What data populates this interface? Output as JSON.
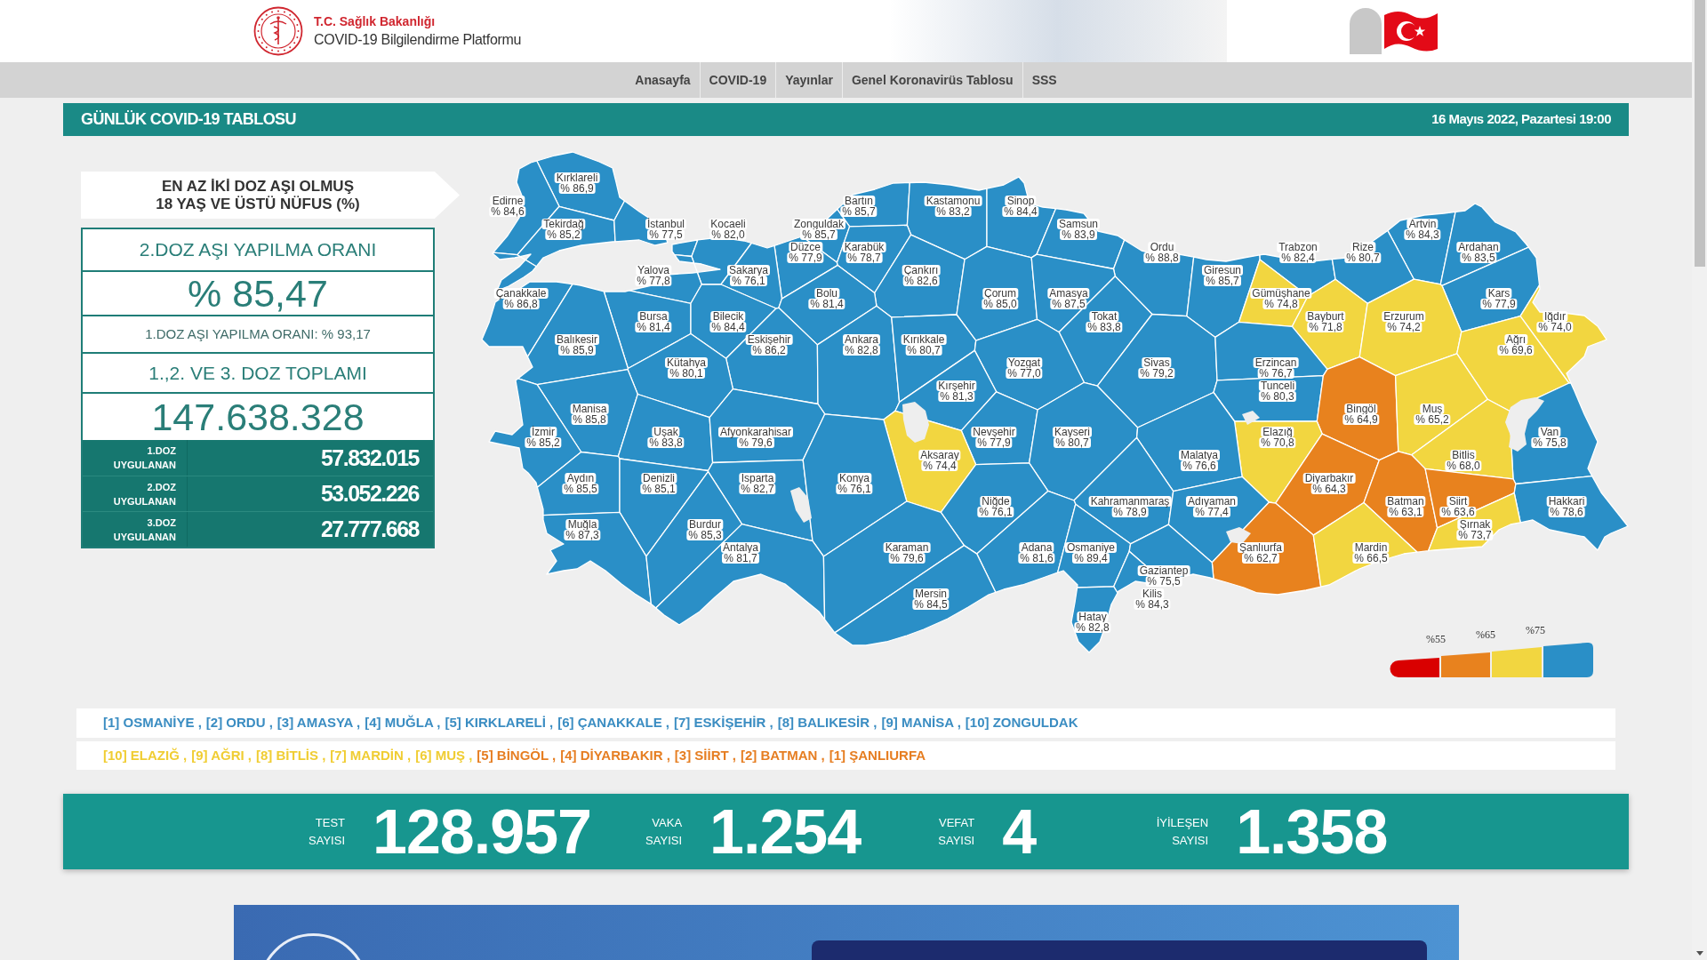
{
  "header": {
    "ministry": "T.C. Sağlık Bakanlığı",
    "platform": "COVID-19 Bilgilendirme Platformu"
  },
  "nav": [
    "Anasayfa",
    "COVID-19",
    "Yayınlar",
    "Genel Koronavirüs Tablosu",
    "SSS"
  ],
  "title_bar": {
    "title": "GÜNLÜK COVID-19 TABLOSU",
    "date": "16 Mayıs 2022, Pazartesi 19:00"
  },
  "vaccination": {
    "heading_lines": [
      "EN AZ İKİ DOZ AŞI OLMUŞ",
      "18 YAŞ VE ÜSTÜ NÜFUS (%)"
    ],
    "second_dose_label": "2.DOZ AŞI YAPILMA ORANI",
    "second_dose_rate": "% 85,47",
    "first_dose_rate": "1.DOZ AŞI YAPILMA ORANI: % 93,17",
    "total_label": "1.,2. VE 3. DOZ TOPLAMI",
    "total": "147.638.328",
    "doses": [
      {
        "label_lines": [
          "1.DOZ",
          "UYGULANAN"
        ],
        "value": "57.832.015"
      },
      {
        "label_lines": [
          "2.DOZ",
          "UYGULANAN"
        ],
        "value": "53.052.226"
      },
      {
        "label_lines": [
          "3.DOZ",
          "UYGULANAN"
        ],
        "value": "27.777.668"
      }
    ]
  },
  "map": {
    "provinces": [
      {
        "name": "Kırklareli",
        "value": "% 86,9",
        "color": "#2a8fc7"
      },
      {
        "name": "Edirne",
        "value": "% 84,6",
        "color": "#2a8fc7"
      },
      {
        "name": "Bartın",
        "value": "% 85,7",
        "color": "#2a8fc7"
      },
      {
        "name": "Kastamonu",
        "value": "% 83,2",
        "color": "#2a8fc7"
      },
      {
        "name": "Sinop",
        "value": "% 84,4",
        "color": "#2a8fc7"
      },
      {
        "name": "Tekirdağ",
        "value": "% 85,2",
        "color": "#2a8fc7"
      },
      {
        "name": "İstanbul",
        "value": "% 77,5",
        "color": "#2a8fc7"
      },
      {
        "name": "Kocaeli",
        "value": "% 82,0",
        "color": "#2a8fc7"
      },
      {
        "name": "Zonguldak",
        "value": "% 85,7",
        "color": "#2a8fc7"
      },
      {
        "name": "Samsun",
        "value": "% 83,9",
        "color": "#2a8fc7"
      },
      {
        "name": "Artvin",
        "value": "% 84,3",
        "color": "#2a8fc7"
      },
      {
        "name": "Düzce",
        "value": "% 77,9",
        "color": "#2a8fc7"
      },
      {
        "name": "Karabük",
        "value": "% 78,7",
        "color": "#2a8fc7"
      },
      {
        "name": "Ordu",
        "value": "% 88,8",
        "color": "#2a8fc7"
      },
      {
        "name": "Trabzon",
        "value": "% 82,4",
        "color": "#2a8fc7"
      },
      {
        "name": "Rize",
        "value": "% 80,7",
        "color": "#2a8fc7"
      },
      {
        "name": "Ardahan",
        "value": "% 83,5",
        "color": "#2a8fc7"
      },
      {
        "name": "Yalova",
        "value": "% 77,8",
        "color": "#2a8fc7"
      },
      {
        "name": "Sakarya",
        "value": "% 76,1",
        "color": "#2a8fc7"
      },
      {
        "name": "Çankırı",
        "value": "% 82,6",
        "color": "#2a8fc7"
      },
      {
        "name": "Giresun",
        "value": "% 85,7",
        "color": "#2a8fc7"
      },
      {
        "name": "Çanakkale",
        "value": "% 86,8",
        "color": "#2a8fc7"
      },
      {
        "name": "Bolu",
        "value": "% 81,4",
        "color": "#2a8fc7"
      },
      {
        "name": "Çorum",
        "value": "% 85,0",
        "color": "#2a8fc7"
      },
      {
        "name": "Amasya",
        "value": "% 87,5",
        "color": "#2a8fc7"
      },
      {
        "name": "Gümüşhane",
        "value": "% 74,8",
        "color": "#f2d640"
      },
      {
        "name": "Kars",
        "value": "% 77,9",
        "color": "#2a8fc7"
      },
      {
        "name": "Bursa",
        "value": "% 81,4",
        "color": "#2a8fc7"
      },
      {
        "name": "Bilecik",
        "value": "% 84,4",
        "color": "#2a8fc7"
      },
      {
        "name": "Tokat",
        "value": "% 83,8",
        "color": "#2a8fc7"
      },
      {
        "name": "Bayburt",
        "value": "% 71,8",
        "color": "#f2d640"
      },
      {
        "name": "Erzurum",
        "value": "% 74,2",
        "color": "#f2d640"
      },
      {
        "name": "Iğdır",
        "value": "% 74,0",
        "color": "#f2d640"
      },
      {
        "name": "Balıkesir",
        "value": "% 85,9",
        "color": "#2a8fc7"
      },
      {
        "name": "Eskişehir",
        "value": "% 86,2",
        "color": "#2a8fc7"
      },
      {
        "name": "Ankara",
        "value": "% 82,8",
        "color": "#2a8fc7"
      },
      {
        "name": "Kırıkkale",
        "value": "% 80,7",
        "color": "#2a8fc7"
      },
      {
        "name": "Ağrı",
        "value": "% 69,6",
        "color": "#f2d640"
      },
      {
        "name": "Kütahya",
        "value": "% 80,1",
        "color": "#2a8fc7"
      },
      {
        "name": "Yozgat",
        "value": "% 77,0",
        "color": "#2a8fc7"
      },
      {
        "name": "Sivas",
        "value": "% 79,2",
        "color": "#2a8fc7"
      },
      {
        "name": "Erzincan",
        "value": "% 76,7",
        "color": "#2a8fc7"
      },
      {
        "name": "Kırşehir",
        "value": "% 81,3",
        "color": "#2a8fc7"
      },
      {
        "name": "Tunceli",
        "value": "% 80,3",
        "color": "#2a8fc7"
      },
      {
        "name": "Manisa",
        "value": "% 85,8",
        "color": "#2a8fc7"
      },
      {
        "name": "Bingöl",
        "value": "% 64,9",
        "color": "#e8821e"
      },
      {
        "name": "Muş",
        "value": "% 65,2",
        "color": "#f2d640"
      },
      {
        "name": "İzmir",
        "value": "% 85,2",
        "color": "#2a8fc7"
      },
      {
        "name": "Uşak",
        "value": "% 83,8",
        "color": "#2a8fc7"
      },
      {
        "name": "Afyonkarahisar",
        "value": "% 79,6",
        "color": "#2a8fc7"
      },
      {
        "name": "Nevşehir",
        "value": "% 77,9",
        "color": "#2a8fc7"
      },
      {
        "name": "Kayseri",
        "value": "% 80,7",
        "color": "#2a8fc7"
      },
      {
        "name": "Elazığ",
        "value": "% 70,8",
        "color": "#f2d640"
      },
      {
        "name": "Van",
        "value": "% 75,8",
        "color": "#2a8fc7"
      },
      {
        "name": "Aksaray",
        "value": "% 74,4",
        "color": "#f2d640"
      },
      {
        "name": "Malatya",
        "value": "% 76,6",
        "color": "#2a8fc7"
      },
      {
        "name": "Bitlis",
        "value": "% 68,0",
        "color": "#f2d640"
      },
      {
        "name": "Aydın",
        "value": "% 85,5",
        "color": "#2a8fc7"
      },
      {
        "name": "Denizli",
        "value": "% 85,1",
        "color": "#2a8fc7"
      },
      {
        "name": "Isparta",
        "value": "% 82,7",
        "color": "#2a8fc7"
      },
      {
        "name": "Konya",
        "value": "% 76,1",
        "color": "#2a8fc7"
      },
      {
        "name": "Diyarbakır",
        "value": "% 64,3",
        "color": "#e8821e"
      },
      {
        "name": "Niğde",
        "value": "% 76,1",
        "color": "#2a8fc7"
      },
      {
        "name": "Kahramanmaraş",
        "value": "% 78,9",
        "color": "#2a8fc7"
      },
      {
        "name": "Adıyaman",
        "value": "% 77,4",
        "color": "#2a8fc7"
      },
      {
        "name": "Batman",
        "value": "% 63,1",
        "color": "#e8821e"
      },
      {
        "name": "Siirt",
        "value": "% 63,6",
        "color": "#e8821e"
      },
      {
        "name": "Hakkari",
        "value": "% 78,6",
        "color": "#2a8fc7"
      },
      {
        "name": "Muğla",
        "value": "% 87,3",
        "color": "#2a8fc7"
      },
      {
        "name": "Burdur",
        "value": "% 85,3",
        "color": "#2a8fc7"
      },
      {
        "name": "Şırnak",
        "value": "% 73,7",
        "color": "#f2d640"
      },
      {
        "name": "Antalya",
        "value": "% 81,7",
        "color": "#2a8fc7"
      },
      {
        "name": "Karaman",
        "value": "% 79,6",
        "color": "#2a8fc7"
      },
      {
        "name": "Adana",
        "value": "% 81,6",
        "color": "#2a8fc7"
      },
      {
        "name": "Osmaniye",
        "value": "% 89,4",
        "color": "#2a8fc7"
      },
      {
        "name": "Şanlıurfa",
        "value": "% 62,7",
        "color": "#e8821e"
      },
      {
        "name": "Mardin",
        "value": "% 66,5",
        "color": "#f2d640"
      },
      {
        "name": "Gaziantep",
        "value": "% 75,5",
        "color": "#2a8fc7"
      },
      {
        "name": "Mersin",
        "value": "% 84,5",
        "color": "#2a8fc7"
      },
      {
        "name": "Kilis",
        "value": "% 84,3",
        "color": "#2a8fc7"
      },
      {
        "name": "Hatay",
        "value": "% 82,8",
        "color": "#2a8fc7"
      }
    ],
    "legend": {
      "ticks": [
        "%55",
        "%65",
        "%75"
      ],
      "bands": [
        {
          "color": "#d90000"
        },
        {
          "color": "#e8821e"
        },
        {
          "color": "#f2d640"
        },
        {
          "color": "#2a8fc7"
        }
      ]
    }
  },
  "rankings": {
    "highest": [
      {
        "text": "[1] OSMANİYE ,",
        "color": "#3b8dc2"
      },
      {
        "text": "[2] ORDU ,",
        "color": "#3b8dc2"
      },
      {
        "text": "[3] AMASYA ,",
        "color": "#3b8dc2"
      },
      {
        "text": "[4] MUĞLA ,",
        "color": "#3b8dc2"
      },
      {
        "text": "[5] KIRKLARELİ ,",
        "color": "#3b8dc2"
      },
      {
        "text": "[6] ÇANAKKALE ,",
        "color": "#3b8dc2"
      },
      {
        "text": "[7] ESKİŞEHİR ,",
        "color": "#3b8dc2"
      },
      {
        "text": "[8] BALIKESİR ,",
        "color": "#3b8dc2"
      },
      {
        "text": "[9] MANİSA ,",
        "color": "#3b8dc2"
      },
      {
        "text": "[10] ZONGULDAK",
        "color": "#3b8dc2"
      }
    ],
    "lowest": [
      {
        "text": "[10] ELAZIĞ ,",
        "color": "#f0cd33"
      },
      {
        "text": "[9] AĞRI ,",
        "color": "#f0cd33"
      },
      {
        "text": "[8] BİTLİS ,",
        "color": "#f0cd33"
      },
      {
        "text": "[7] MARDİN ,",
        "color": "#f0cd33"
      },
      {
        "text": "[6] MUŞ ,",
        "color": "#f0cd33"
      },
      {
        "text": "[5] BİNGÖL ,",
        "color": "#e67e22"
      },
      {
        "text": "[4] DİYARBAKIR ,",
        "color": "#e67e22"
      },
      {
        "text": "[3] SİİRT ,",
        "color": "#e67e22"
      },
      {
        "text": "[2] BATMAN ,",
        "color": "#e67e22"
      },
      {
        "text": "[1] ŞANLIURFA",
        "color": "#e67e22"
      }
    ]
  },
  "stats": [
    {
      "label_lines": [
        "TEST",
        "SAYISI"
      ],
      "value": "128.957"
    },
    {
      "label_lines": [
        "VAKA",
        "SAYISI"
      ],
      "value": "1.254"
    },
    {
      "label_lines": [
        "VEFAT",
        "SAYISI"
      ],
      "value": "4"
    },
    {
      "label_lines": [
        "İYİLEŞEN",
        "SAYISI"
      ],
      "value": "1.358"
    }
  ]
}
